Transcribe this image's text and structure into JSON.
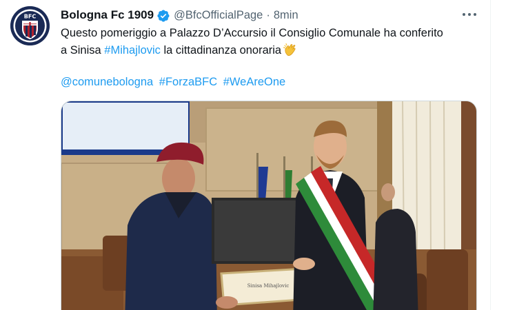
{
  "tweet": {
    "author": {
      "display_name": "Bologna Fc 1909",
      "handle": "@BfcOfficialPage",
      "separator": "·",
      "time": "8min",
      "avatar_text": "BFC",
      "verified": true
    },
    "text": {
      "line1": "Questo pomeriggio a Palazzo D’Accursio il Consiglio Comunale ha conferito",
      "line2_prefix": "a Sinisa ",
      "line2_mention": "#Mihajlovic",
      "line2_suffix": " la cittadinanza onoraria",
      "emoji": "clapping-hands-icon"
    },
    "links": [
      "@comunebologna",
      "#ForzaBFC",
      "#WeAreOne"
    ],
    "media": {
      "type": "photo",
      "certificate_text": "Sinisa Mihajlovic"
    },
    "menu_icon": "more-horizontal-icon"
  },
  "colors": {
    "link": "#1d9bf0",
    "secondary_text": "#536471",
    "primary_text": "#0f1419",
    "verified": "#1d9bf0",
    "club_red": "#b0202c",
    "club_navy": "#1a2a55"
  }
}
